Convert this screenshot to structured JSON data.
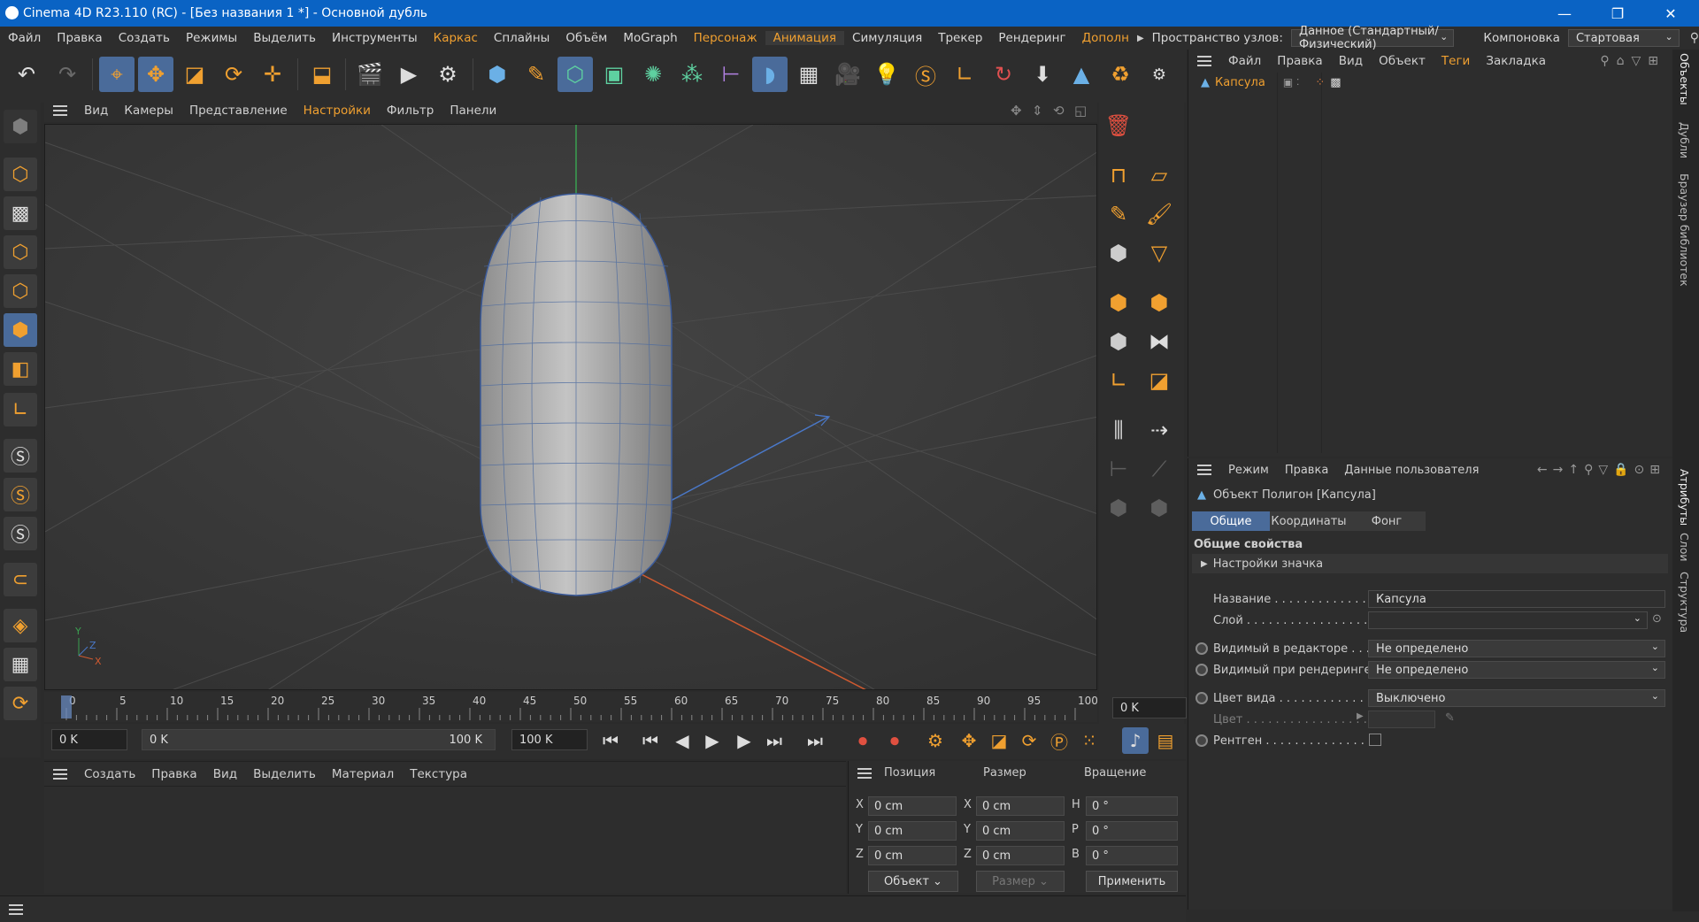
{
  "window": {
    "title": "Cinema 4D R23.110 (RC) - [Без названия 1 *] - Основной дубль",
    "minimize": "—",
    "maximize": "❐",
    "close": "✕"
  },
  "menu": {
    "items": [
      "Файл",
      "Правка",
      "Создать",
      "Режимы",
      "Выделить",
      "Инструменты",
      "Каркас",
      "Сплайны",
      "Объём",
      "MoGraph",
      "Персонаж",
      "Анимация",
      "Симуляция",
      "Трекер",
      "Рендеринг",
      "Дополн"
    ],
    "highlighted": [
      "Каркас",
      "Персонаж",
      "Анимация",
      "Дополн"
    ],
    "nodespace_label": "Пространство узлов:",
    "nodespace_value": "Данное (Стандартный/Физический)",
    "layout_label": "Компоновка",
    "layout_value": "Стартовая"
  },
  "viewport": {
    "menu": [
      "Вид",
      "Камеры",
      "Представление",
      "Настройки",
      "Фильтр",
      "Панели"
    ],
    "highlighted": [
      "Настройки"
    ],
    "object": "Капсула",
    "axis_y": "Y",
    "axis_z": "Z",
    "axis_x": "X"
  },
  "timeline": {
    "ticks": [
      "0",
      "5",
      "10",
      "15",
      "20",
      "25",
      "30",
      "35",
      "40",
      "45",
      "50",
      "55",
      "60",
      "65",
      "70",
      "75",
      "80",
      "85",
      "90",
      "95",
      "100"
    ],
    "current_frame": "0 K",
    "start_field": "0 K",
    "range_start": "0 K",
    "range_end": "100 K",
    "end_field": "100 K"
  },
  "material_manager": {
    "menu": [
      "Создать",
      "Правка",
      "Вид",
      "Выделить",
      "Материал",
      "Текстура"
    ]
  },
  "coordinates": {
    "headers": [
      "Позиция",
      "Размер",
      "Вращение"
    ],
    "rows": [
      {
        "a": "X",
        "pos": "0 cm",
        "b": "X",
        "size": "0 cm",
        "c": "H",
        "rot": "0 °"
      },
      {
        "a": "Y",
        "pos": "0 cm",
        "b": "Y",
        "size": "0 cm",
        "c": "P",
        "rot": "0 °"
      },
      {
        "a": "Z",
        "pos": "0 cm",
        "b": "Z",
        "size": "0 cm",
        "c": "B",
        "rot": "0 °"
      }
    ],
    "mode": "Объект",
    "size_mode": "Размер",
    "apply": "Применить"
  },
  "object_manager": {
    "menu": [
      "Файл",
      "Правка",
      "Вид",
      "Объект",
      "Теги",
      "Закладка"
    ],
    "highlighted": [
      "Теги"
    ],
    "items": [
      {
        "name": "Капсула"
      }
    ]
  },
  "attributes": {
    "menu": [
      "Режим",
      "Правка",
      "Данные пользователя"
    ],
    "header": "Объект Полигон [Капсула]",
    "tabs": [
      "Общие",
      "Координаты",
      "Фонг"
    ],
    "active_tab": "Общие",
    "section": "Общие свойства",
    "subsection": "Настройки значка",
    "fields": {
      "name_label": "Название . . . . . . . . . . . . . .",
      "name_value": "Капсула",
      "layer_label": "Слой . . . . . . . . . . . . . . . . . .",
      "layer_value": "",
      "vis_editor_label": "Видимый в редакторе . . .",
      "vis_editor_value": "Не определено",
      "vis_render_label": "Видимый при рендеринге",
      "vis_render_value": "Не определено",
      "display_color_label": "Цвет вида . . . . . . . . . . . .",
      "display_color_value": "Выключено",
      "color_label": "Цвет . . . . . . . . . . . . . . . . .",
      "xray_label": "Рентген . . . . . . . . . . . . . . ."
    }
  },
  "side_tabs": [
    "Объекты",
    "Дубли",
    "Браузер библиотек",
    "Атрибуты",
    "Слои",
    "Структура"
  ],
  "colors": {
    "accent": "#f0a030",
    "selection": "#4a6b9a",
    "title_bar": "#0a63c4"
  }
}
